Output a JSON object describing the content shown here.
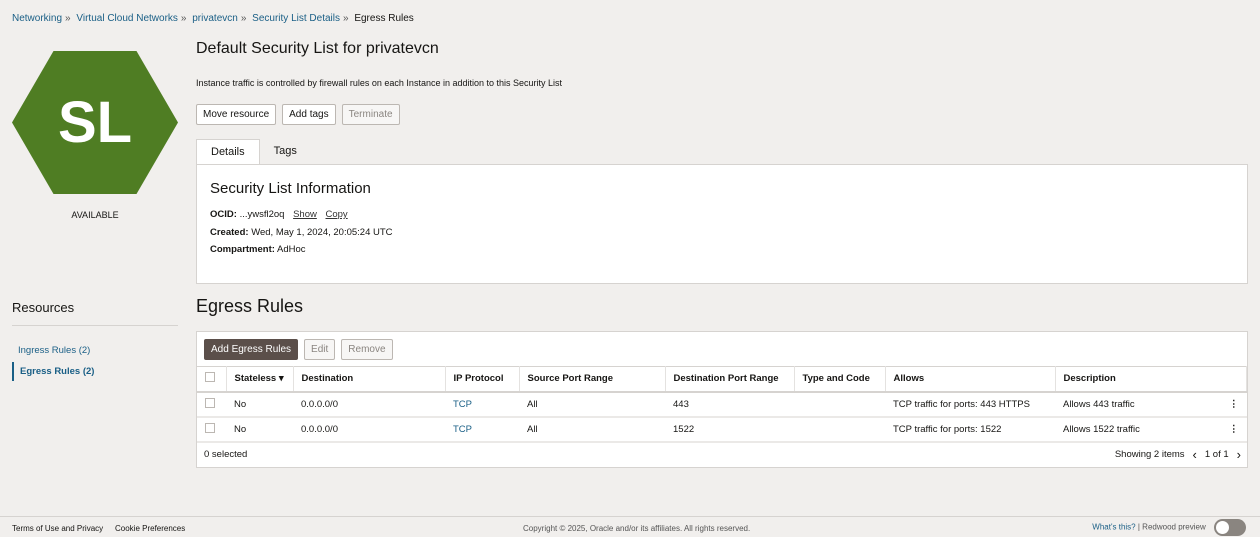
{
  "breadcrumb": [
    "Networking",
    "Virtual Cloud Networks",
    "privatevcn",
    "Security List Details"
  ],
  "breadcrumb_current": "Egress Rules",
  "breadcrumb_sep": "»",
  "badge": {
    "initials": "SL",
    "color": "#4f7d23",
    "status": "AVAILABLE"
  },
  "header": {
    "title": "Default Security List for privatevcn",
    "subtitle": "Instance traffic is controlled by firewall rules on each Instance in addition to this Security List"
  },
  "actions": {
    "move": "Move resource",
    "tags": "Add tags",
    "terminate": "Terminate"
  },
  "tabs": [
    "Details",
    "Tags"
  ],
  "info": {
    "title": "Security List Information",
    "ocid_label": "OCID:",
    "ocid": "...ywsfl2oq",
    "show": "Show",
    "copy": "Copy",
    "created_label": "Created:",
    "created": "Wed, May 1, 2024, 20:05:24 UTC",
    "compartment_label": "Compartment:",
    "compartment": "AdHoc"
  },
  "resources": {
    "title": "Resources",
    "items": [
      "Ingress Rules (2)",
      "Egress Rules (2)"
    ]
  },
  "egress": {
    "title": "Egress Rules",
    "add": "Add Egress Rules",
    "edit": "Edit",
    "remove": "Remove",
    "columns": [
      "Stateless ▾",
      "Destination",
      "IP Protocol",
      "Source Port Range",
      "Destination Port Range",
      "Type and Code",
      "Allows",
      "Description"
    ],
    "rows": [
      [
        "No",
        "0.0.0.0/0",
        "TCP",
        "All",
        "443",
        "",
        "TCP traffic for ports: 443 HTTPS",
        "Allows 443 traffic"
      ],
      [
        "No",
        "0.0.0.0/0",
        "TCP",
        "All",
        "1522",
        "",
        "TCP traffic for ports: 1522",
        "Allows 1522 traffic"
      ]
    ],
    "selected": "0 selected",
    "showing": "Showing 2 items",
    "page": "1 of 1"
  },
  "footer": {
    "terms": "Terms of Use and Privacy",
    "cookies": "Cookie Preferences",
    "copyright": "Copyright © 2025, Oracle and/or its affiliates. All rights reserved.",
    "whats": "What's this?",
    "sep": "|",
    "redwood": "Redwood preview"
  }
}
